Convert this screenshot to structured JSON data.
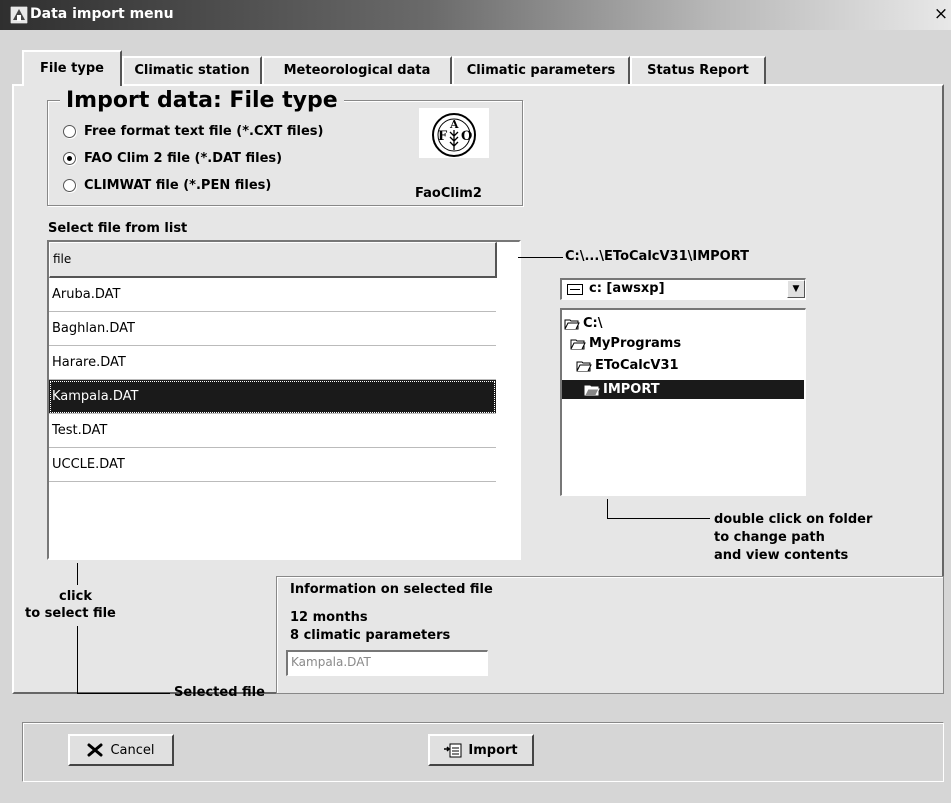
{
  "window": {
    "title": "Data import menu",
    "close_glyph": "×"
  },
  "tabs": [
    {
      "label": "File type",
      "active": true
    },
    {
      "label": "Climatic station",
      "active": false
    },
    {
      "label": "Meteorological data",
      "active": false
    },
    {
      "label": "Climatic parameters",
      "active": false
    },
    {
      "label": "Status Report",
      "active": false
    }
  ],
  "import_group": {
    "title": "Import data:  File type",
    "options": [
      {
        "label": "Free format text file (*.CXT files)",
        "checked": false
      },
      {
        "label": "FAO Clim 2 file (*.DAT files)",
        "checked": true
      },
      {
        "label": "CLIMWAT file (*.PEN files)",
        "checked": false
      }
    ],
    "logo_label": "FaoClim2"
  },
  "file_list": {
    "label": "Select file from list",
    "header": "file",
    "files": [
      "Aruba.DAT",
      "Baghlan.DAT",
      "Harare.DAT",
      "Kampala.DAT",
      "Test.DAT",
      "UCCLE.DAT"
    ],
    "selected_index": 3
  },
  "path": "C:\\...\\EToCalcV31\\IMPORT",
  "drive": {
    "value": "c: [awsxp]"
  },
  "folders": [
    {
      "label": "C:\\",
      "selected": false
    },
    {
      "label": "MyPrograms",
      "selected": false
    },
    {
      "label": "EToCalcV31",
      "selected": false
    },
    {
      "label": "IMPORT",
      "selected": true
    }
  ],
  "folder_note": [
    "double click on folder",
    "to change path",
    "and view contents"
  ],
  "click_note": [
    "click",
    "to select file"
  ],
  "info": {
    "title": "Information on selected file",
    "months": "12 months",
    "parameters": "8 climatic parameters",
    "selected_label": "Selected file",
    "selected_value": "Kampala.DAT"
  },
  "buttons": {
    "cancel": "Cancel",
    "import": "Import"
  },
  "colors": {
    "selection": "#1a1a1a",
    "panel": "#e6e6e6",
    "window_bg": "#d6d6d6"
  }
}
